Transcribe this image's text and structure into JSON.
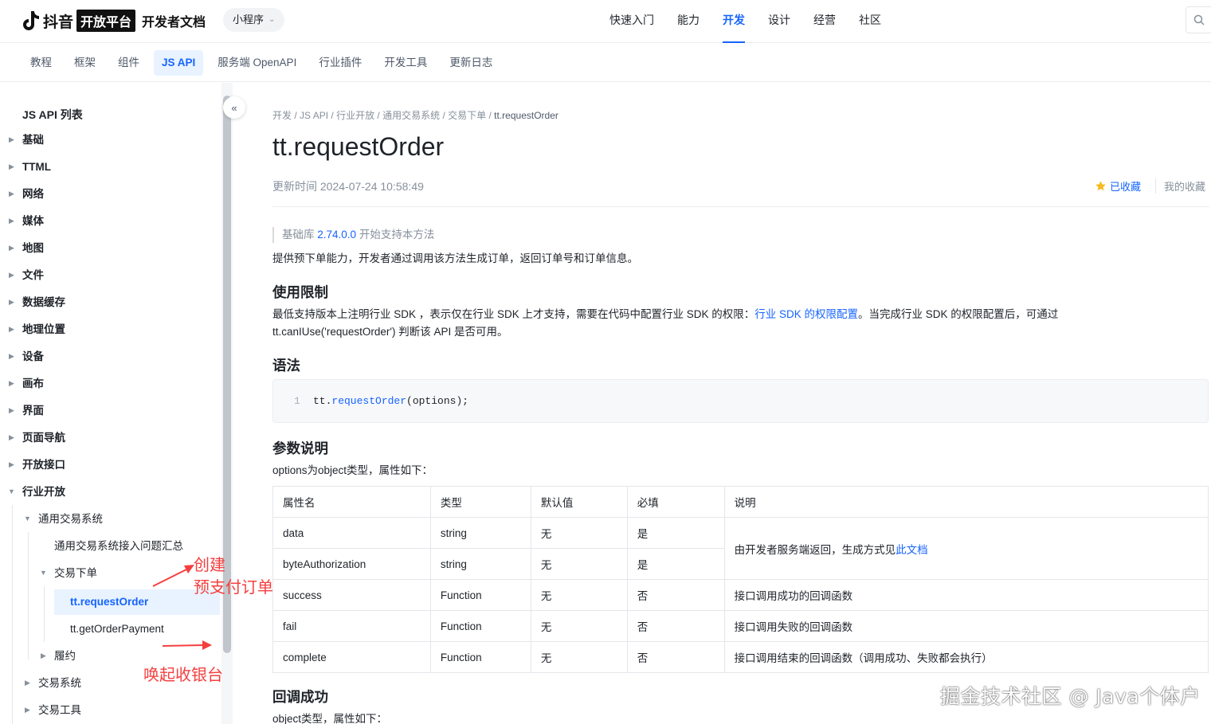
{
  "header": {
    "brand": "抖音",
    "badge": "开放平台",
    "doc_title": "开发者文档",
    "selector": "小程序",
    "nav": [
      "快速入门",
      "能力",
      "开发",
      "设计",
      "经营",
      "社区"
    ],
    "active_nav": "开发"
  },
  "subnav": {
    "tabs": [
      "教程",
      "框架",
      "组件",
      "JS API",
      "服务端 OpenAPI",
      "行业插件",
      "开发工具",
      "更新日志"
    ],
    "active": "JS API"
  },
  "sidebar": {
    "title": "JS API 列表",
    "items": [
      "基础",
      "TTML",
      "网络",
      "媒体",
      "地图",
      "文件",
      "数据缓存",
      "地理位置",
      "设备",
      "画布",
      "界面",
      "页面导航",
      "开放接口",
      "行业开放"
    ],
    "sub": {
      "group": "通用交易系统",
      "faq": "通用交易系统接入问题汇总",
      "order": "交易下单",
      "request_order": "tt.requestOrder",
      "get_payment": "tt.getOrderPayment",
      "fulfill": "履约",
      "trade_sys": "交易系统",
      "trade_tools": "交易工具"
    }
  },
  "annotations": {
    "create_line1": "创建",
    "create_line2": "预支付订单",
    "cashier": "唤起收银台",
    "color": "#f53f3f"
  },
  "content": {
    "breadcrumb": [
      "开发",
      "JS API",
      "行业开放",
      "通用交易系统",
      "交易下单",
      "tt.requestOrder"
    ],
    "title": "tt.requestOrder",
    "updated": "更新时间 2024-07-24 10:58:49",
    "favorited": "已收藏",
    "my_favorites": "我的收藏",
    "since_prefix": "基础库",
    "since_version": "2.74.0.0",
    "since_suffix": "开始支持本方法",
    "intro": "提供预下单能力，开发者通过调用该方法生成订单，返回订单号和订单信息。",
    "limit_title": "使用限制",
    "limit_text1": "最低支持版本上注明行业 SDK ，表示仅在行业 SDK 上才支持，需要在代码中配置行业 SDK 的权限：",
    "limit_link": "行业 SDK 的权限配置",
    "limit_text2": "。当完成行业 SDK 的权限配置后，可通过",
    "limit_text3": "tt.canIUse('requestOrder') 判断该 API 是否可用。",
    "syntax_title": "语法",
    "code_line_no": "1",
    "code_obj": "tt.",
    "code_fn": "requestOrder",
    "code_args": "(options);",
    "params_title": "参数说明",
    "params_intro": "options为object类型，属性如下：",
    "table_headers": [
      "属性名",
      "类型",
      "默认值",
      "必填",
      "说明"
    ],
    "rows": [
      [
        "data",
        "string",
        "无",
        "是"
      ],
      [
        "byteAuthorization",
        "string",
        "无",
        "是"
      ],
      [
        "success",
        "Function",
        "无",
        "否",
        "接口调用成功的回调函数"
      ],
      [
        "fail",
        "Function",
        "无",
        "否",
        "接口调用失败的回调函数"
      ],
      [
        "complete",
        "Function",
        "无",
        "否",
        "接口调用结束的回调函数（调用成功、失败都会执行）"
      ]
    ],
    "merged_desc_prefix": "由开发者服务端返回，生成方式见",
    "merged_desc_link": "此文档",
    "callback_title": "回调成功",
    "callback_intro": "object类型，属性如下："
  },
  "watermark": "掘金技术社区 @ Java个体户",
  "colors": {
    "accent": "#1664ff",
    "active_bg": "#e8f3ff",
    "annotation": "#f53f3f"
  }
}
